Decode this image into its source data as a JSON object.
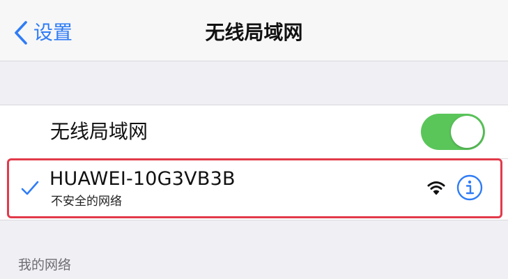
{
  "nav": {
    "back_label": "设置",
    "title": "无线局域网"
  },
  "wifi": {
    "toggle_label": "无线局域网",
    "toggle_on": true,
    "toggle_color": "#5ac65a"
  },
  "connected_network": {
    "ssid": "HUAWEI-10G3VB3B",
    "security_note": "不安全的网络",
    "signal_icon": "wifi-icon",
    "info_icon": "info-icon",
    "check_icon": "checkmark-icon",
    "highlight_color": "#e23a4a"
  },
  "sections": {
    "my_networks": "我的网络"
  },
  "colors": {
    "accent": "#2f7cf6",
    "background": "#efeff4"
  }
}
